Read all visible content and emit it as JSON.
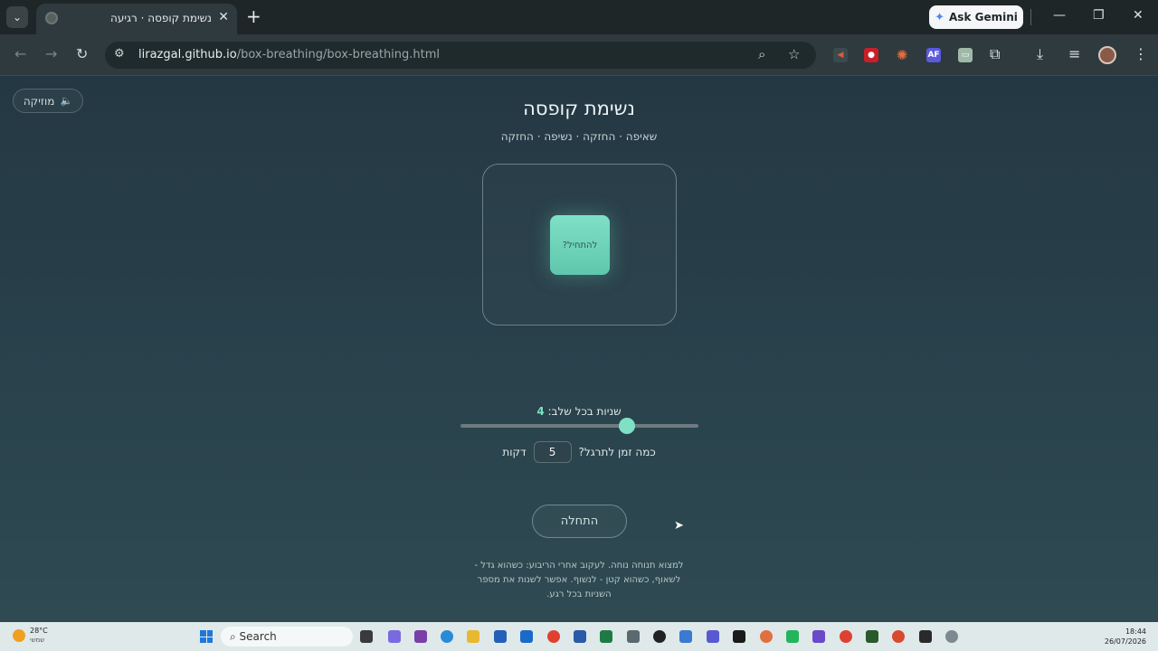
{
  "browser": {
    "tab_title": "נשימת קופסה · רגיעה",
    "gemini_label": "Ask Gemini",
    "url_host": "lirazgal.github.io",
    "url_path": "/box-breathing/box-breathing.html",
    "extensions": [
      "AF"
    ]
  },
  "page": {
    "music_label": "מוזיקה",
    "title": "נשימת קופסה",
    "subtitle": "שאיפה · החזקה · נשיפה · החזקה",
    "square_label": "להתחיל?",
    "seconds_label": "שניות בכל שלב:",
    "seconds_value": "4",
    "seconds_fraction": 0.7,
    "minutes_label": "כמה זמן לתרגל?",
    "minutes_value": "5",
    "minutes_unit": "דקות",
    "start_label": "התחלה",
    "hint_lines": [
      "למצוא תנוחה נוחה. לעקוב אחרי הריבוע: כשהוא גדל -",
      "לשאוף, כשהוא קטן - לנשוף. אפשר לשנות את מספר",
      "השניות בכל רגע."
    ]
  },
  "taskbar": {
    "weather_temp": "28°C",
    "weather_desc": "שמשי",
    "search_label": "Search",
    "time": "18:44",
    "date": "26/07/2026"
  },
  "colors": {
    "accent": "#7fe0c6",
    "background": "#2a3b45"
  }
}
